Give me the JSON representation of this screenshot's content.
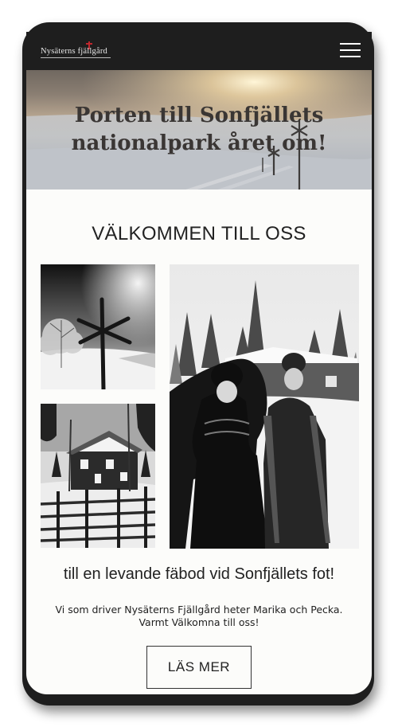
{
  "header": {
    "logo_text": "Nysäterns fjällgård",
    "menu_icon": "hamburger-menu-icon"
  },
  "hero": {
    "title_line1": "Porten till Sonfjällets",
    "title_line2": "nationalpark året om!"
  },
  "main": {
    "heading": "VÄLKOMMEN TILL OSS",
    "tagline": "till en levande fäbod vid Sonfjällets fot!",
    "intro": "Vi som driver Nysäterns Fjällgård heter Marika och Pecka. Varmt Välkomna till oss!",
    "cta_label": "LÄS MER"
  },
  "colors": {
    "frame": "#1e1e1e",
    "page_bg": "#fcfcfa",
    "text": "#222222",
    "accent_red": "#c0272d"
  }
}
